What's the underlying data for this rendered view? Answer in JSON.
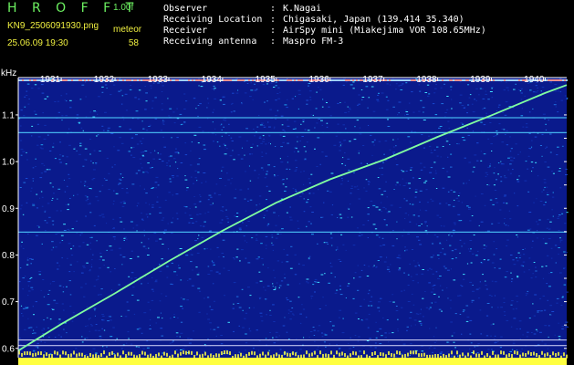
{
  "header": {
    "brand": "H R O F F T",
    "version": "1.00f",
    "filename": "KN9_2506091930.png",
    "meteor_label": "meteor",
    "datetime": "25.06.09 19:30",
    "meteor_count": "58",
    "info": [
      {
        "label": "Observer",
        "value": "K.Nagai"
      },
      {
        "label": "Receiving Location",
        "value": "Chigasaki, Japan (139.414 35.340)"
      },
      {
        "label": "Receiver",
        "value": "AirSpy mini (Miakejima VOR 108.65MHz)"
      },
      {
        "label": "Receiving antenna",
        "value": "Maspro FM-3"
      }
    ],
    "colon": ":"
  },
  "colors": {
    "background": "#000000",
    "brand": "#6cf060",
    "label_yellow": "#f0f040",
    "noise_low": "#0a1a8c",
    "noise_high": "#40e0ff",
    "trace": "#80ffa0",
    "baseline": "#ffff40"
  },
  "chart_data": {
    "type": "heatmap",
    "ylabel": "kHz",
    "y_ticks": [
      "1.1",
      "1.0",
      "0.9",
      "0.8",
      "0.7",
      "0.6"
    ],
    "y_tick_values": [
      1.1,
      1.0,
      0.9,
      0.8,
      0.7,
      0.6
    ],
    "ylim": [
      0.58,
      1.18
    ],
    "x_ticks": [
      "1931",
      "1932",
      "1933",
      "1934",
      "1935",
      "1936",
      "1937",
      "1938",
      "1939",
      "1940"
    ],
    "xlim": [
      1930.2,
      1940.4
    ],
    "carriers_khz": [
      1.094,
      1.062,
      0.849,
      0.618,
      0.606
    ],
    "trace": {
      "x": [
        1930.2,
        1931,
        1932,
        1933,
        1934,
        1935,
        1936,
        1937,
        1938,
        1939,
        1940,
        1940.4
      ],
      "y": [
        0.595,
        0.652,
        0.718,
        0.787,
        0.852,
        0.912,
        0.962,
        1.004,
        1.053,
        1.099,
        1.147,
        1.164
      ]
    }
  }
}
